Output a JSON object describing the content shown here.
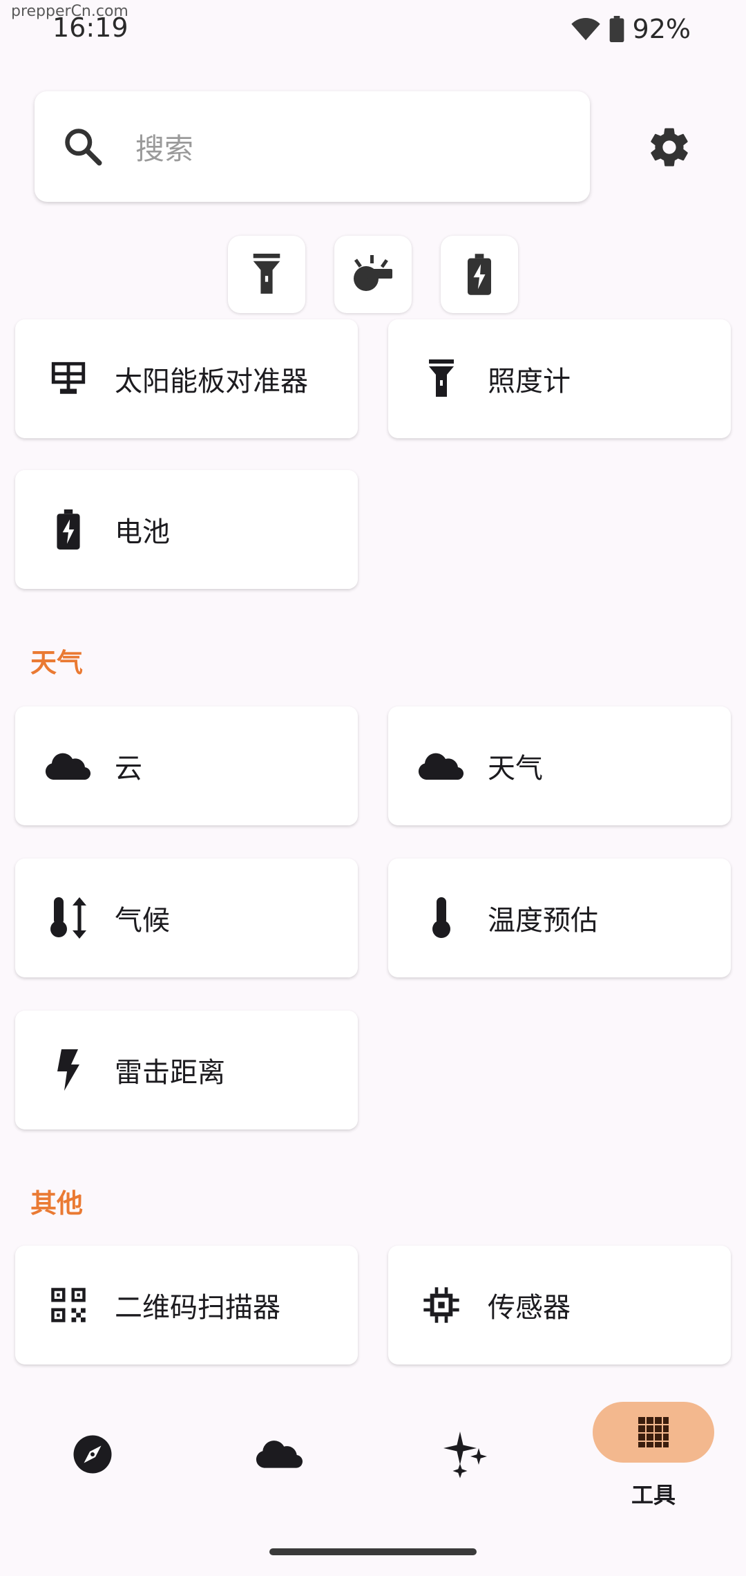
{
  "status_bar": {
    "watermark": "prepperCn.com",
    "time": "16:19",
    "battery": "92%"
  },
  "search": {
    "placeholder": "搜索"
  },
  "quick_actions": [
    "flashlight-icon",
    "whistle-icon",
    "battery-icon"
  ],
  "tools": {
    "power_cards": [
      {
        "label": "太阳能板对准器",
        "icon": "solar-panel-icon"
      },
      {
        "label": "照度计",
        "icon": "flashlight-icon"
      },
      {
        "label": "电池",
        "icon": "battery-icon"
      }
    ],
    "weather_section": "天气",
    "weather_cards": [
      {
        "label": "云",
        "icon": "cloud-icon"
      },
      {
        "label": "天气",
        "icon": "cloud-icon"
      },
      {
        "label": "气候",
        "icon": "thermometer-arrows-icon"
      },
      {
        "label": "温度预估",
        "icon": "thermometer-icon"
      },
      {
        "label": "雷击距离",
        "icon": "lightning-icon"
      }
    ],
    "other_section": "其他",
    "other_cards": [
      {
        "label": "二维码扫描器",
        "icon": "qr-code-icon"
      },
      {
        "label": "传感器",
        "icon": "chip-icon"
      }
    ]
  },
  "bottom_nav": {
    "items": [
      "compass-icon",
      "cloud-icon",
      "sparkles-icon",
      "grid-icon"
    ],
    "active_label": "工具"
  },
  "colors": {
    "accent": "#ea7a33",
    "nav_pill": "#f3b88e",
    "background": "#fcf8fc"
  }
}
